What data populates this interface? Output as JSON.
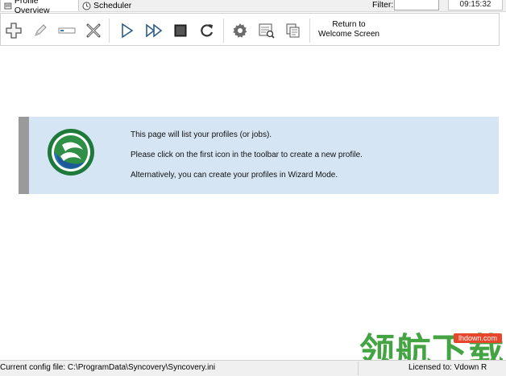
{
  "tabs": {
    "profile_overview": "Profile Overview",
    "scheduler": "Scheduler"
  },
  "filter": {
    "label": "Filter:",
    "value": ""
  },
  "clock": "09:15:32",
  "toolbar": {
    "buttons": [
      {
        "icon": "plus-icon"
      },
      {
        "icon": "pencil-icon"
      },
      {
        "icon": "rename-icon"
      },
      {
        "icon": "delete-x-icon"
      },
      {
        "icon": "play-icon"
      },
      {
        "icon": "fast-forward-icon"
      },
      {
        "icon": "stop-icon"
      },
      {
        "icon": "refresh-icon"
      },
      {
        "icon": "gear-icon"
      },
      {
        "icon": "log-icon"
      },
      {
        "icon": "copy-icon"
      }
    ],
    "welcome_line1": "Return to",
    "welcome_line2": "Welcome Screen"
  },
  "info": {
    "line1": "This page will list your profiles (or jobs).",
    "line2": "Please click on the first icon in the toolbar to create a new profile.",
    "line3": "Alternatively, you can create your profiles in Wizard Mode."
  },
  "status": {
    "config": "Current config file: C:\\ProgramData\\Syncovery\\Syncovery.ini",
    "license": "Licensed to: Vdown R"
  },
  "watermark": {
    "text": "领航下载",
    "url": "lhdown.com"
  }
}
